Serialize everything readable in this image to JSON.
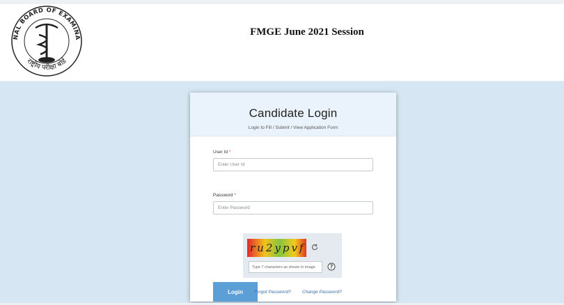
{
  "header": {
    "title": "FMGE June 2021 Session",
    "logo": {
      "icon": "nbe-emblem-logo",
      "text_top": "NATIONAL BOARD OF EXAMINATIONS",
      "text_bottom": "राष्ट्रीय परीक्षा बोर्ड"
    }
  },
  "login": {
    "title": "Candidate Login",
    "subtitle": "Login to Fill / Submit / View Application Form",
    "user_id": {
      "label": "User Id",
      "required": "*",
      "placeholder": "Enter User Id",
      "value": ""
    },
    "password": {
      "label": "Password",
      "required": "*",
      "placeholder": "Enter Password",
      "value": ""
    },
    "captcha": {
      "text": "ru2ypvf",
      "placeholder": "Type 7 characters as shown in image",
      "refresh_icon": "refresh-icon",
      "help_icon": "help-icon"
    },
    "login_label": "Login",
    "forgot_password": "Forgot Password?",
    "change_password": "Change Password?"
  },
  "colors": {
    "page_bg": "#d6e6f2",
    "card_head_bg": "#eaf3fb",
    "button_bg": "#5b9fd6",
    "link": "#3a6fb0"
  }
}
